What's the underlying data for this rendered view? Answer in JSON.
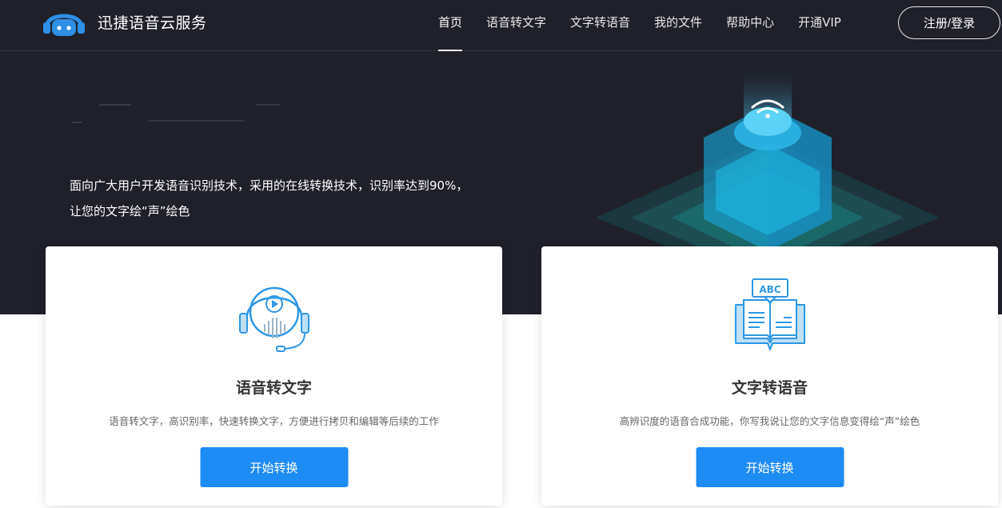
{
  "brand": {
    "name": "迅捷语音云服务",
    "logo_icon": "robot-headphones-icon"
  },
  "nav": {
    "items": [
      {
        "label": "首页",
        "active": true
      },
      {
        "label": "语音转文字",
        "active": false
      },
      {
        "label": "文字转语音",
        "active": false
      },
      {
        "label": "我的文件",
        "active": false
      },
      {
        "label": "帮助中心",
        "active": false
      },
      {
        "label": "开通VIP",
        "active": false
      }
    ],
    "login_label": "注册/登录"
  },
  "hero": {
    "description": "面向广大用户开发语音识别技术，采用的在线转换技术，识别率达到90%，让您的文字绘“声”绘色",
    "illustration_icon": "cloud-cube-wifi-icon"
  },
  "cards": [
    {
      "icon": "headset-play-icon",
      "title": "语音转文字",
      "description": "语音转文字，高识别率，快速转换文字，方便进行拷贝和编辑等后续的工作",
      "button_label": "开始转换"
    },
    {
      "icon": "book-abc-icon",
      "title": "文字转语音",
      "description": "高辨识度的语音合成功能，你写我说让您的文字信息变得绘“声”绘色",
      "button_label": "开始转换"
    }
  ],
  "colors": {
    "hero_background": "#1f2029",
    "accent": "#1e8cf5",
    "icon_blue": "#2e97e4",
    "illustration_cyan": "#1fb4e6"
  }
}
